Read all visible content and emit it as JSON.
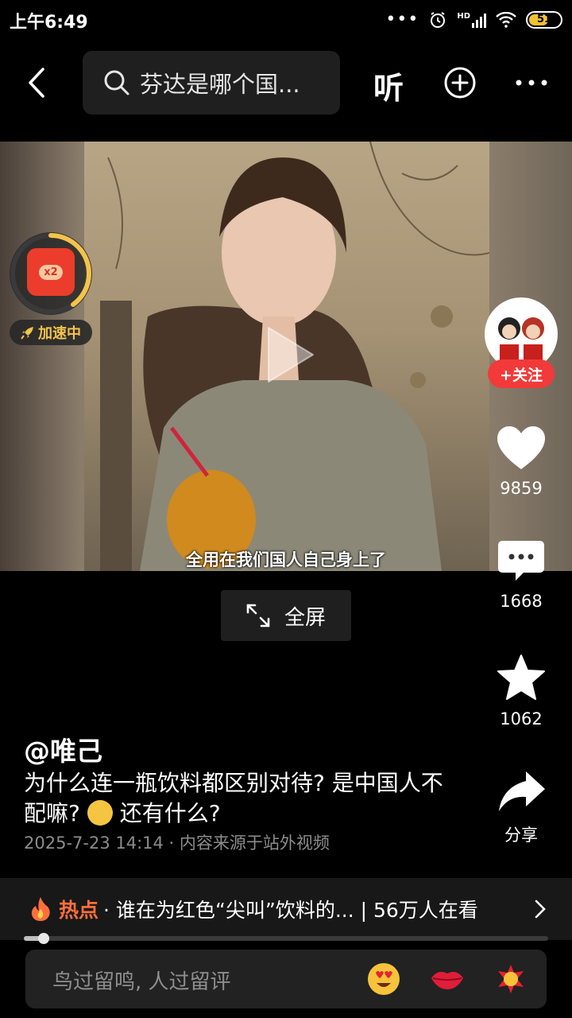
{
  "status_bar": {
    "time": "上午6:49",
    "signal": "HD",
    "battery": "51"
  },
  "top_nav": {
    "search_text": "芬达是哪个国...",
    "listen_label": "听"
  },
  "video": {
    "subtitle": "全用在我们国人自己身上了"
  },
  "reward": {
    "multiplier": "x2",
    "label": "加速中",
    "progress": 0.4
  },
  "author_panel": {
    "follow_label": "+关注"
  },
  "actions": {
    "likes": "9859",
    "comments": "1668",
    "favorites": "1062",
    "share_label": "分享"
  },
  "fullscreen": {
    "label": "全屏"
  },
  "post": {
    "author": "@唯己",
    "description_part1": "为什么连一瓶饮料都区别对待? 是中国人不配嘛?",
    "description_part2": "还有什么?",
    "meta": "2025-7-23 14:14 · 内容来源于站外视频"
  },
  "hot": {
    "label": "热点",
    "text": "· 谁在为红色“尖叫”饮料的... | 56万人在看"
  },
  "playback": {
    "progress": 0.038
  },
  "comment": {
    "placeholder": "鸟过留鸣, 人过留评"
  },
  "colors": {
    "accent_red": "#f23a3a",
    "hot_orange": "#ff6f3c",
    "reward_gold": "#f4c34a"
  }
}
